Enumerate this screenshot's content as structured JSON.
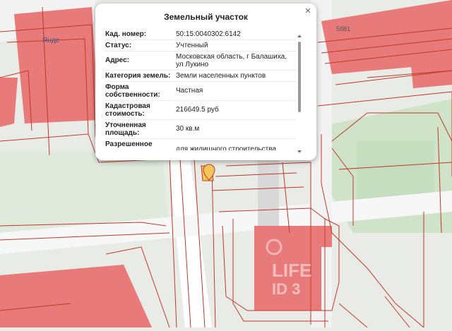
{
  "popup": {
    "title": "Земельный участок",
    "rows": [
      {
        "label": "Кад. номер:",
        "value": "50:15:0040302:6142"
      },
      {
        "label": "Статус:",
        "value": "Учтенный"
      },
      {
        "label": "Адрес:",
        "value": "Московская область, г Балашиха, ул Лукино"
      },
      {
        "label": "Категория земель:",
        "value": "Земли населенных пунктов"
      },
      {
        "label": "Форма собственности:",
        "value": "Частная"
      },
      {
        "label": "Кадастровая стоимость:",
        "value": "216649.5 руб"
      },
      {
        "label": "Уточненная площадь:",
        "value": "30 кв.м"
      },
      {
        "label": "Разрешенное",
        "value": "для жилищного строительства"
      }
    ],
    "close_icon": "close-icon"
  },
  "map": {
    "label_left": "Янде",
    "house_number_top_right": "5б81",
    "watermark_top": "LIFE",
    "watermark_bottom": "ID 3",
    "colors": {
      "building": "#e87a7a",
      "parcel_line": "#c0392b",
      "green": "#cfe3c8",
      "road": "#ffffff",
      "ground": "#e9ece6"
    }
  }
}
